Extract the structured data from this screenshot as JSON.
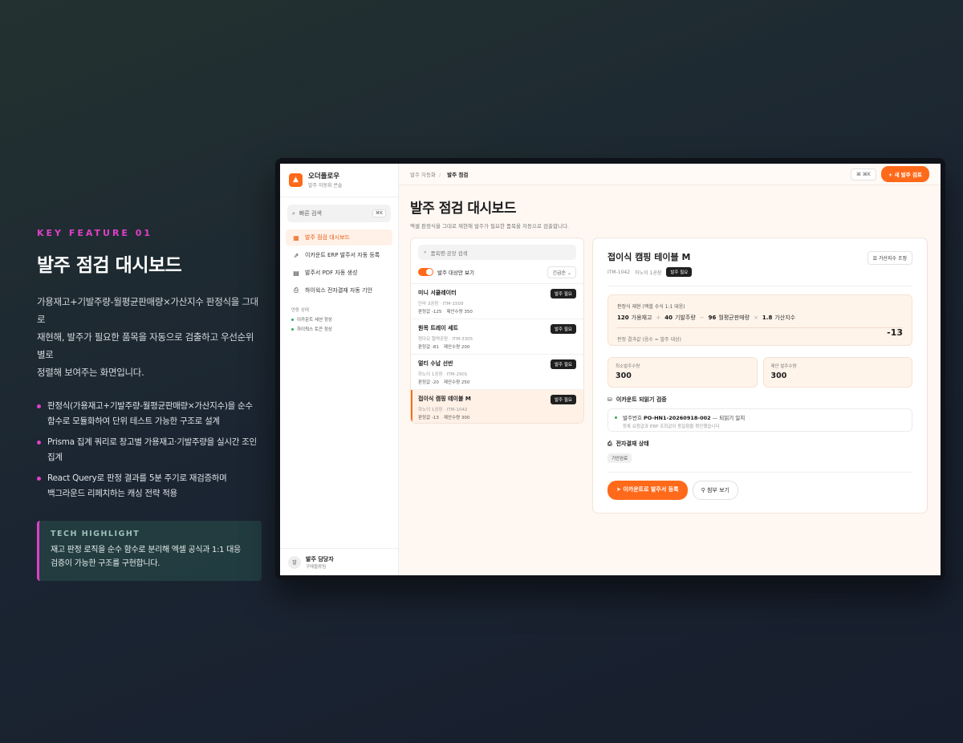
{
  "promo": {
    "kicker": "KEY FEATURE 01",
    "title": "발주 점검 대시보드",
    "desc_line1": "가용재고+기발주량-월평균판매량×가산지수 판정식을 그대로",
    "desc_line2": "재현해, 발주가 필요한 품목을 자동으로 검출하고 우선순위별로",
    "desc_line3": "정렬해 보여주는 화면입니다.",
    "bullets": [
      {
        "line1": "판정식(가용재고+기발주량-월평균판매량×가산지수)을 순수",
        "line2": "함수로 모듈화하여 단위 테스트 가능한 구조로 설계"
      },
      {
        "line1": "Prisma 집계 쿼리로 창고별 가용재고·기발주량을 실시간 조인",
        "line2": "집계"
      },
      {
        "line1": "React Query로 판정 결과를 5분 주기로 재검증하며",
        "line2": "백그라운드 리페치하는 캐싱 전략 적용"
      }
    ],
    "tech_label": "TECH HIGHLIGHT",
    "tech_line1": "재고 판정 로직을 순수 함수로 분리해 엑셀 공식과 1:1 대응",
    "tech_line2": "검증이 가능한 구조를 구현합니다."
  },
  "sidebar": {
    "brand_name": "오더플로우",
    "brand_sub": "발주 자동화 콘솔",
    "search_label": "빠른 검색",
    "search_kbd": "⌘K",
    "items": [
      {
        "icon": "▦",
        "label": "발주 점검 대시보드"
      },
      {
        "icon": "⇗",
        "label": "이카운트 ERP 발주서 자동 등록"
      },
      {
        "icon": "▤",
        "label": "발주서 PDF 자동 생성"
      },
      {
        "icon": "⎙",
        "label": "하이웍스 전자결재 자동 기안"
      }
    ],
    "status_title": "연동 상태",
    "status": [
      "이카운트 세션 정상",
      "하이웍스 토큰 정상"
    ],
    "user_avatar": "발",
    "user_name": "발주 담당자",
    "user_role": "구매물류팀"
  },
  "topbar": {
    "crumb_parent": "발주 자동화",
    "crumb_sep": "/",
    "crumb_current": "발주 점검",
    "cmdk": "⌘ ⌘K",
    "new_button": "+ 새 발주 검토"
  },
  "page": {
    "title": "발주 점검 대시보드",
    "subtitle": "엑셀 판정식을 그대로 재현해 발주가 필요한 품목을 자동으로 검출합니다."
  },
  "list": {
    "search_placeholder": "품목명·공장 검색",
    "toggle_label": "발주 대상만 보기",
    "sort": "긴급순",
    "items": [
      {
        "name": "미니 서큘레이터",
        "meta": "단라 3공장 · ITM-1509",
        "judge": "판정값 -125",
        "suggest": "제안수량 350",
        "badge": "발주 필요"
      },
      {
        "name": "원목 트레이 세트",
        "meta": "청다오 협력공장 · ITM-3305",
        "judge": "판정값 -81",
        "suggest": "제안수량 200",
        "badge": "발주 필요"
      },
      {
        "name": "멀티 수납 선반",
        "meta": "하노이 1공장 · ITM-2901",
        "judge": "판정값 -20",
        "suggest": "제안수량 250",
        "badge": "발주 필요"
      },
      {
        "name": "접이식 캠핑 테이블 M",
        "meta": "하노이 1공장 · ITM-1042",
        "judge": "판정값 -13",
        "suggest": "제안수량 300",
        "badge": "발주 필요"
      }
    ]
  },
  "detail": {
    "title": "접이식 캠핑 테이블 M",
    "code": "ITM-1042",
    "factory": "하노이 1공장",
    "badge": "발주 필요",
    "adjust_button": "가산지수 조정",
    "formula_label": "판정식 재현 (엑셀 수식 1:1 대응)",
    "f1_val": "120",
    "f1_label": "가용재고",
    "op1": "+",
    "f2_val": "40",
    "f2_label": "기발주량",
    "op2": "−",
    "f3_val": "96",
    "f3_label": "월평균판매량",
    "op3": "×",
    "f4_val": "1.8",
    "f4_label": "가산지수",
    "result_label": "판정 결과값 (음수 = 발주 대상)",
    "result": "-13",
    "min_qty_label": "최소발주수량",
    "min_qty": "300",
    "suggest_qty_label": "제안 발주수량",
    "suggest_qty": "300",
    "verify_title": "이카운트 되읽기 검증",
    "verify_prefix": "발주번호",
    "verify_no": "PO-HN1-20260918-002",
    "verify_suffix": "— 되읽기 일치",
    "verify_sub": "등록 요청값과 ERP 조회값이 동일함을 확인했습니다",
    "approval_title": "전자결재 상태",
    "approval_chip": "기안완료",
    "primary_button": "이카운트로 발주서 등록",
    "secondary_button": "첨부 보기"
  }
}
